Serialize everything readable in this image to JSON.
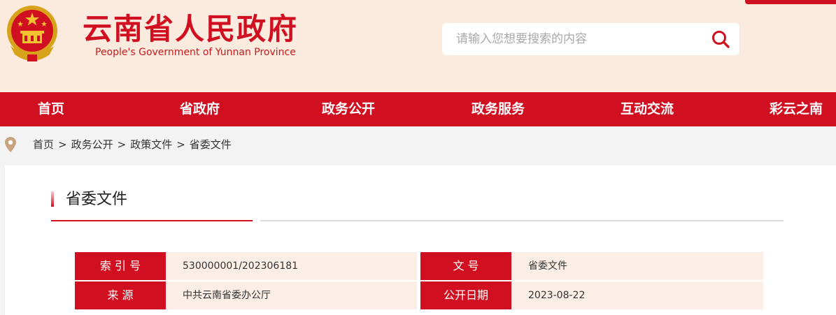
{
  "header": {
    "title": "云南省人民政府",
    "subtitle": "People's Government of Yunnan Province",
    "emblem_icon": "national-emblem-icon"
  },
  "search": {
    "placeholder": "请输入您想要搜索的内容",
    "button_icon": "search-icon"
  },
  "nav": {
    "items": [
      {
        "label": "首页"
      },
      {
        "label": "省政府"
      },
      {
        "label": "政务公开"
      },
      {
        "label": "政务服务"
      },
      {
        "label": "互动交流"
      },
      {
        "label": "彩云之南"
      }
    ]
  },
  "breadcrumb": {
    "icon": "location-pin-icon",
    "items": [
      "首页",
      "政务公开",
      "政策文件",
      "省委文件"
    ],
    "separator": ">"
  },
  "section": {
    "title": "省委文件"
  },
  "meta": {
    "index_label": "索 引 号",
    "index_value": "530000001/202306181",
    "doc_label": "文      号",
    "doc_value": "省委文件",
    "source_label": "来      源",
    "source_value": "中共云南省委办公厅",
    "date_label": "公开日期",
    "date_value": "2023-08-22"
  },
  "colors": {
    "brand_red": "#d01021",
    "header_bg": "#fbeade",
    "meta_value_bg": "#fbeee6"
  }
}
